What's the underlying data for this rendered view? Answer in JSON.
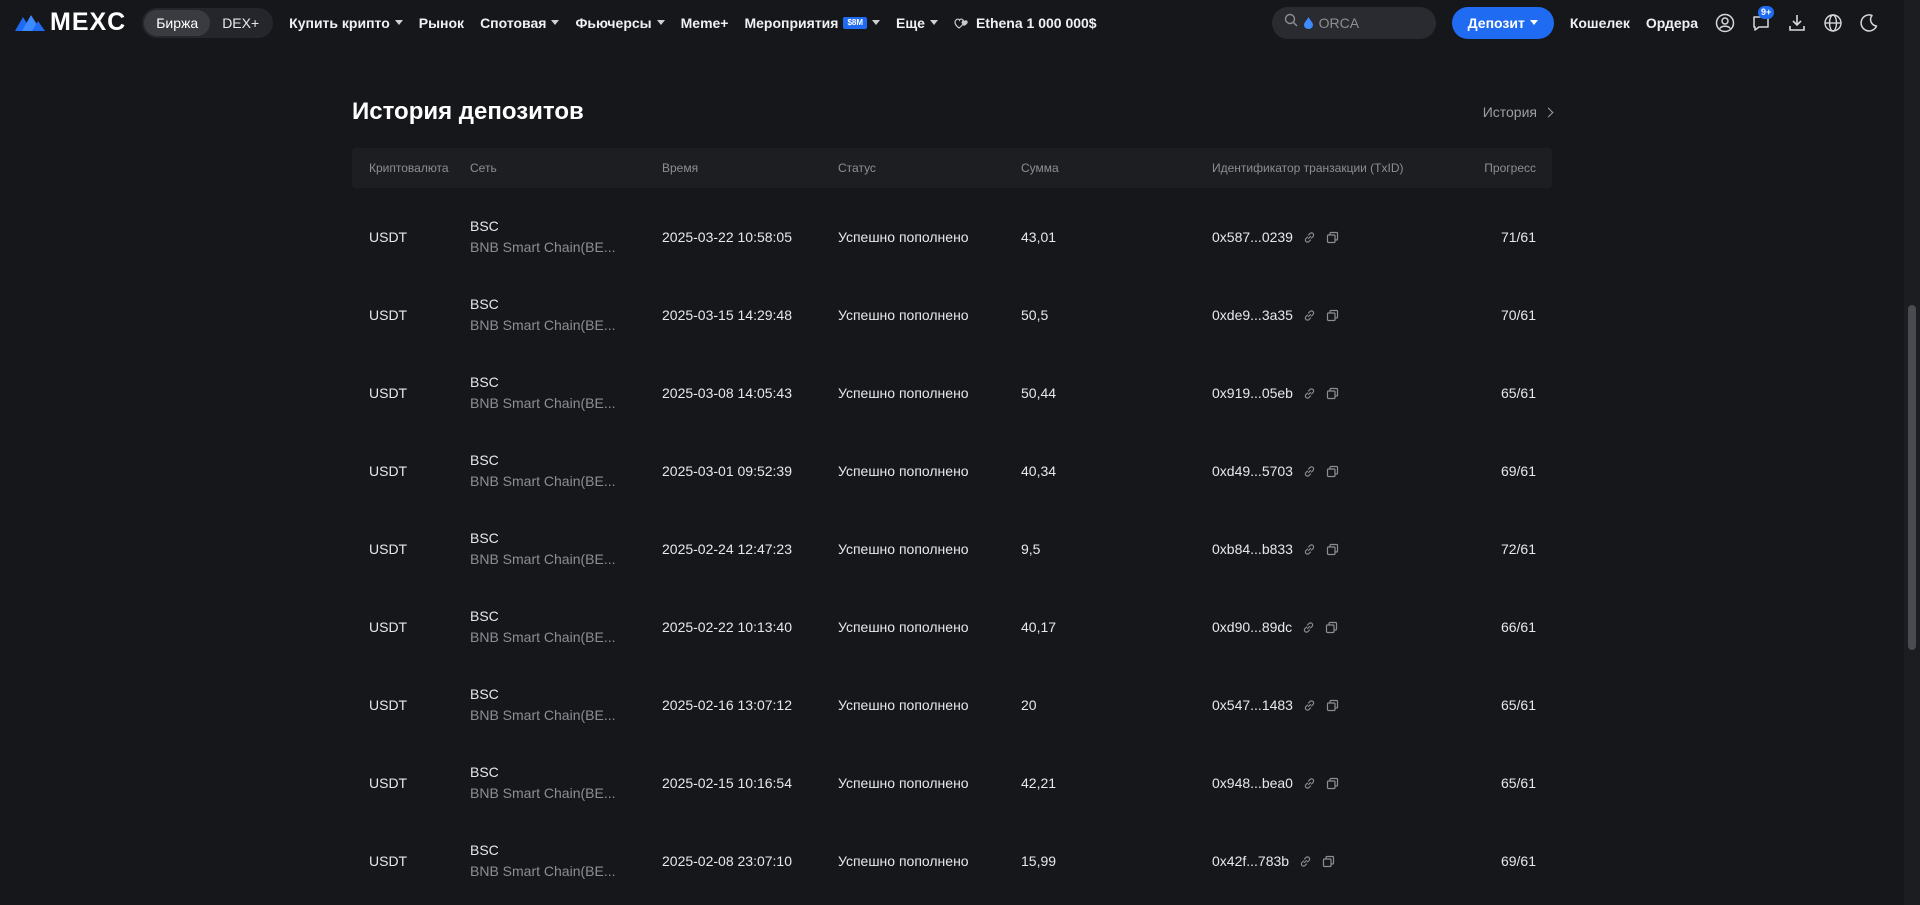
{
  "header": {
    "logo_text": "MEXC",
    "segment": [
      {
        "label": "Биржа",
        "active": true
      },
      {
        "label": "DEX+",
        "active": false
      }
    ],
    "nav": [
      {
        "label": "Купить крипто",
        "dropdown": true
      },
      {
        "label": "Рынок",
        "dropdown": false
      },
      {
        "label": "Спотовая",
        "dropdown": true
      },
      {
        "label": "Фьючерсы",
        "dropdown": true
      },
      {
        "label": "Meme+",
        "dropdown": false
      },
      {
        "label": "Мероприятия",
        "dropdown": true,
        "badge": "$8M"
      },
      {
        "label": "Еще",
        "dropdown": true
      }
    ],
    "promo": "Ethena 1 000 000$",
    "search_placeholder": "ORCA",
    "deposit_label": "Депозит",
    "wallet_label": "Кошелек",
    "orders_label": "Ордера",
    "notifications_count": "9+",
    "colors": {
      "accent": "#1f6cf3",
      "background": "#16171b"
    }
  },
  "main": {
    "title": "История депозитов",
    "history_link": "История",
    "columns": {
      "coin": "Криптовалюта",
      "network": "Сеть",
      "time": "Время",
      "status": "Статус",
      "amount": "Сумма",
      "txid": "Идентификатор транзакции (TxID)",
      "progress": "Прогресс"
    },
    "rows": [
      {
        "coin": "USDT",
        "net_code": "BSC",
        "net_name": "BNB Smart Chain(BE...",
        "time": "2025-03-22 10:58:05",
        "status": "Успешно пополнено",
        "amount": "43,01",
        "txid": "0x587...0239",
        "progress": "71/61"
      },
      {
        "coin": "USDT",
        "net_code": "BSC",
        "net_name": "BNB Smart Chain(BE...",
        "time": "2025-03-15 14:29:48",
        "status": "Успешно пополнено",
        "amount": "50,5",
        "txid": "0xde9...3a35",
        "progress": "70/61"
      },
      {
        "coin": "USDT",
        "net_code": "BSC",
        "net_name": "BNB Smart Chain(BE...",
        "time": "2025-03-08 14:05:43",
        "status": "Успешно пополнено",
        "amount": "50,44",
        "txid": "0x919...05eb",
        "progress": "65/61"
      },
      {
        "coin": "USDT",
        "net_code": "BSC",
        "net_name": "BNB Smart Chain(BE...",
        "time": "2025-03-01 09:52:39",
        "status": "Успешно пополнено",
        "amount": "40,34",
        "txid": "0xd49...5703",
        "progress": "69/61"
      },
      {
        "coin": "USDT",
        "net_code": "BSC",
        "net_name": "BNB Smart Chain(BE...",
        "time": "2025-02-24 12:47:23",
        "status": "Успешно пополнено",
        "amount": "9,5",
        "txid": "0xb84...b833",
        "progress": "72/61"
      },
      {
        "coin": "USDT",
        "net_code": "BSC",
        "net_name": "BNB Smart Chain(BE...",
        "time": "2025-02-22 10:13:40",
        "status": "Успешно пополнено",
        "amount": "40,17",
        "txid": "0xd90...89dc",
        "progress": "66/61"
      },
      {
        "coin": "USDT",
        "net_code": "BSC",
        "net_name": "BNB Smart Chain(BE...",
        "time": "2025-02-16 13:07:12",
        "status": "Успешно пополнено",
        "amount": "20",
        "txid": "0x547...1483",
        "progress": "65/61"
      },
      {
        "coin": "USDT",
        "net_code": "BSC",
        "net_name": "BNB Smart Chain(BE...",
        "time": "2025-02-15 10:16:54",
        "status": "Успешно пополнено",
        "amount": "42,21",
        "txid": "0x948...bea0",
        "progress": "65/61"
      },
      {
        "coin": "USDT",
        "net_code": "BSC",
        "net_name": "BNB Smart Chain(BE...",
        "time": "2025-02-08 23:07:10",
        "status": "Успешно пополнено",
        "amount": "15,99",
        "txid": "0x42f...783b",
        "progress": "69/61"
      }
    ]
  }
}
